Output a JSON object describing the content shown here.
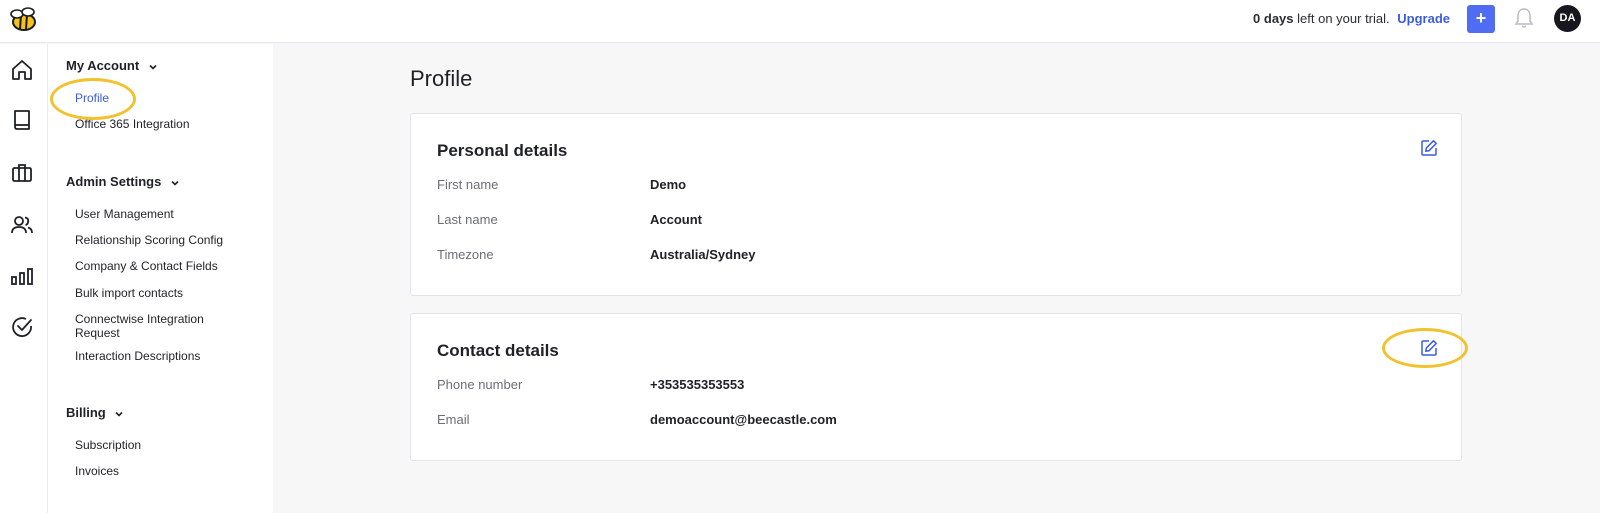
{
  "topbar": {
    "trial_count": "0 days",
    "trial_text": "left on your trial.",
    "upgrade_label": "Upgrade",
    "add_label": "+",
    "avatar_initials": "DA"
  },
  "rail": {
    "icons": [
      "home-icon",
      "book-icon",
      "briefcase-icon",
      "users-icon",
      "bar-chart-icon",
      "check-circle-icon"
    ]
  },
  "sidebar": {
    "my_account": {
      "title": "My Account",
      "items": [
        "Profile",
        "Office 365 Integration"
      ]
    },
    "admin_settings": {
      "title": "Admin Settings",
      "items": [
        "User Management",
        "Relationship Scoring Config",
        "Company & Contact Fields",
        "Bulk import contacts",
        "Connectwise Integration Request",
        "Interaction Descriptions"
      ]
    },
    "billing": {
      "title": "Billing",
      "items": [
        "Subscription",
        "Invoices"
      ]
    }
  },
  "main": {
    "title": "Profile",
    "personal": {
      "title": "Personal details",
      "rows": [
        {
          "label": "First name",
          "value": "Demo"
        },
        {
          "label": "Last name",
          "value": "Account"
        },
        {
          "label": "Timezone",
          "value": "Australia/Sydney"
        }
      ]
    },
    "contact": {
      "title": "Contact details",
      "rows": [
        {
          "label": "Phone number",
          "value": "+353535353553"
        },
        {
          "label": "Email",
          "value": "demoaccount@beecastle.com"
        }
      ]
    }
  },
  "colors": {
    "accent": "#3c5ce0",
    "highlight": "#f2c12e"
  }
}
